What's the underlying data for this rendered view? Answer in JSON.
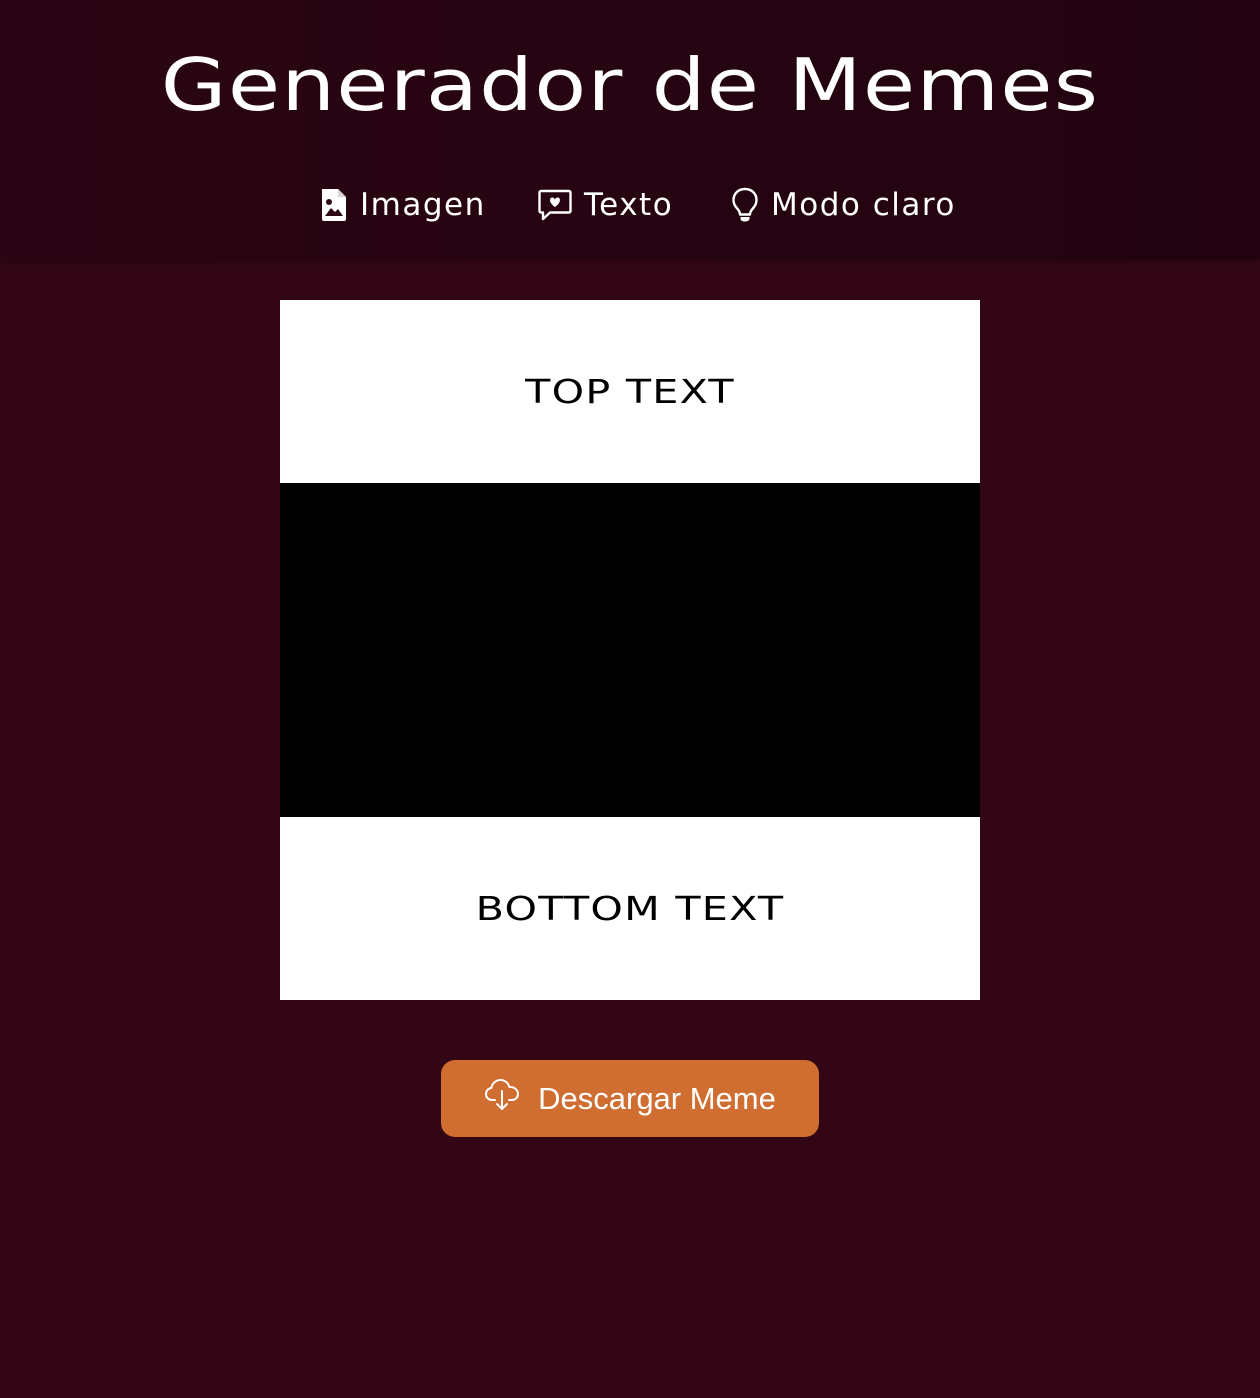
{
  "header": {
    "title": "Generador de Memes",
    "nav": [
      {
        "label": "Imagen",
        "icon": "image-file-icon"
      },
      {
        "label": "Texto",
        "icon": "comment-icon"
      },
      {
        "label": "Modo claro",
        "icon": "lightbulb-icon"
      }
    ]
  },
  "meme": {
    "top_text": "TOP TEXT",
    "bottom_text": "BOTTOM TEXT"
  },
  "download": {
    "label": "Descargar Meme",
    "icon": "cloud-download-icon",
    "color": "#d06d30"
  },
  "colors": {
    "background": "#330616",
    "header": "#250411"
  }
}
